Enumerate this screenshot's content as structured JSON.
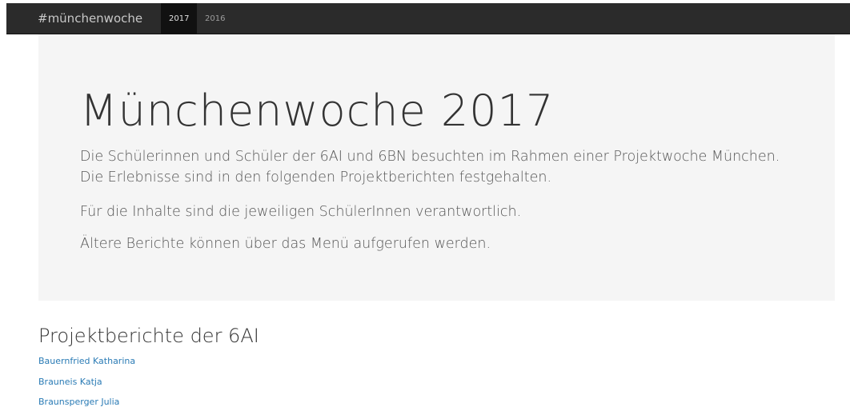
{
  "navbar": {
    "brand": "#münchenwoche",
    "items": [
      {
        "label": "2017",
        "active": true
      },
      {
        "label": "2016",
        "active": false
      }
    ]
  },
  "jumbotron": {
    "title": "Münchenwoche 2017",
    "paragraphs": [
      "Die Schülerinnen und Schüler der 6AI und 6BN besuchten im Rahmen einer Projektwoche München. Die Erlebnisse sind in den folgenden Projektberichten festgehalten.",
      "Für die Inhalte sind die jeweiligen SchülerInnen verantwortlich.",
      "Ältere Berichte können über das Menü aufgerufen werden."
    ]
  },
  "section": {
    "title": "Projektberichte der 6AI",
    "links": [
      "Bauernfried Katharina",
      "Brauneis Katja",
      "Braunsperger Julia"
    ]
  },
  "colors": {
    "navbar_bg": "#2b2b2b",
    "navbar_active_bg": "#111111",
    "jumbotron_bg": "#f5f5f5",
    "link": "#2a7bb5"
  }
}
